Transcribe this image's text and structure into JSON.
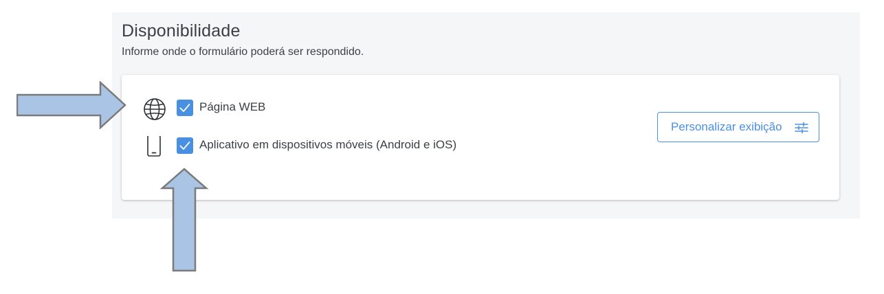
{
  "section": {
    "title": "Disponibilidade",
    "subtitle": "Informe onde o formulário poderá ser respondido."
  },
  "options": [
    {
      "label": "Página WEB",
      "icon": "globe-icon",
      "checked": true
    },
    {
      "label": "Aplicativo em dispositivos móveis (Android e iOS)",
      "icon": "smartphone-icon",
      "checked": true
    }
  ],
  "customize_button": {
    "label": "Personalizar exibição",
    "icon": "sliders-icon"
  },
  "colors": {
    "accent": "#4a90e2",
    "panel_bg": "#f5f6f8",
    "text": "#3b3f45",
    "annotation_arrow_fill": "#aac4e6",
    "annotation_arrow_stroke": "#7a7a7a"
  }
}
